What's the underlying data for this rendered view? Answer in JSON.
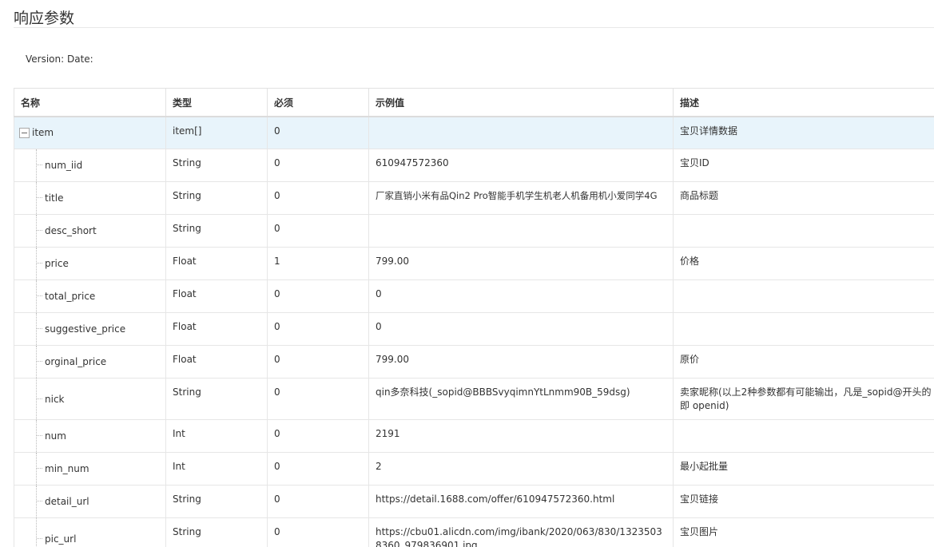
{
  "section_title": "响应参数",
  "version_line": "Version: Date:",
  "table": {
    "headers": [
      "名称",
      "类型",
      "必须",
      "示例值",
      "描述"
    ],
    "rows": [
      {
        "name": "item",
        "type": "item[]",
        "required": "0",
        "example": "",
        "desc": ""
      },
      {
        "name": "num_iid",
        "type": "String",
        "required": "0",
        "example": "610947572360",
        "desc": "宝贝ID"
      },
      {
        "name": "title",
        "type": "String",
        "required": "0",
        "example": "厂家直销小米有品Qin2 Pro智能手机学生机老人机备用机小爱同学4G",
        "desc": "商品标题"
      },
      {
        "name": "desc_short",
        "type": "String",
        "required": "0",
        "example": "",
        "desc": ""
      },
      {
        "name": "price",
        "type": "Float",
        "required": "1",
        "example": "799.00",
        "desc": "价格"
      },
      {
        "name": "total_price",
        "type": "Float",
        "required": "0",
        "example": "0",
        "desc": ""
      },
      {
        "name": "suggestive_price",
        "type": "Float",
        "required": "0",
        "example": "0",
        "desc": ""
      },
      {
        "name": "orginal_price",
        "type": "Float",
        "required": "0",
        "example": "799.00",
        "desc": "原价"
      },
      {
        "name": "nick",
        "type": "String",
        "required": "0",
        "example": "qin多奈科技(_sopid@BBBSvyqimnYtLnmm90B_59dsg)",
        "desc": "卖家昵称(以上2种参数都有可能输出，凡是_sopid@开头的即 openid)"
      },
      {
        "name": "num",
        "type": "Int",
        "required": "0",
        "example": "2191",
        "desc": ""
      },
      {
        "name": "min_num",
        "type": "Int",
        "required": "0",
        "example": "2",
        "desc": "最小起批量"
      },
      {
        "name": "detail_url",
        "type": "String",
        "required": "0",
        "example": "https://detail.1688.com/offer/610947572360.html",
        "desc": "宝贝链接"
      },
      {
        "name": "pic_url",
        "type": "String",
        "required": "0",
        "example": "https://cbu01.alicdn.com/img/ibank/2020/063/830/13235038360_979836901.jpg",
        "desc": "宝贝图片"
      }
    ],
    "root_desc": "宝贝详情数据"
  },
  "colors": {
    "selected_row_bg": "#e8f4fb",
    "border": "#e6e6e6",
    "text": "#333333"
  },
  "icons": {
    "collapse_toggle": "minus-square-icon"
  }
}
